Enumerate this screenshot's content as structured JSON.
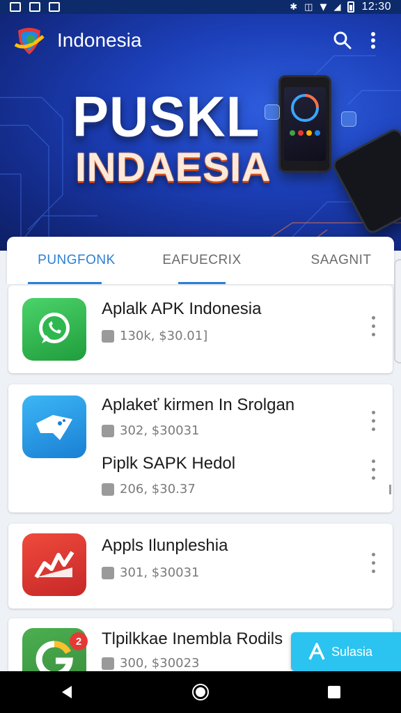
{
  "status_bar": {
    "time": "12:30"
  },
  "app_bar": {
    "title": "Indonesia"
  },
  "hero": {
    "title": "PUSKL",
    "subtitle": "INDAESIA"
  },
  "tabs": [
    {
      "label": "PUNGFONK",
      "active": true
    },
    {
      "label": "EAFUECRIX",
      "active": false
    },
    {
      "label": "SAAGNIT",
      "active": false
    }
  ],
  "list": [
    {
      "title": "Aplalk APK Indonesia",
      "meta": "130k, $30.01]",
      "icon": "whatsapp-icon"
    },
    {
      "title": "Aplakeť kirmen In Srolgan",
      "meta": "302, $30031",
      "icon": "blue-app-icon"
    },
    {
      "title": "Piplk SAPK Hedol",
      "meta": "206, $30.37",
      "icon": "blue-app-icon"
    },
    {
      "title": "Appls Ilunpleshia",
      "meta": "301, $30031",
      "icon": "red-app-icon"
    },
    {
      "title": "Tlpilkkae Inembla Rodils",
      "meta": "300, $30023",
      "icon": "google-app-icon",
      "badge": "2"
    }
  ],
  "fab": {
    "label": "Sulasia"
  },
  "colors": {
    "accent": "#2a7fd6",
    "hero_dark": "#132a86",
    "fab": "#2bc3ef"
  }
}
